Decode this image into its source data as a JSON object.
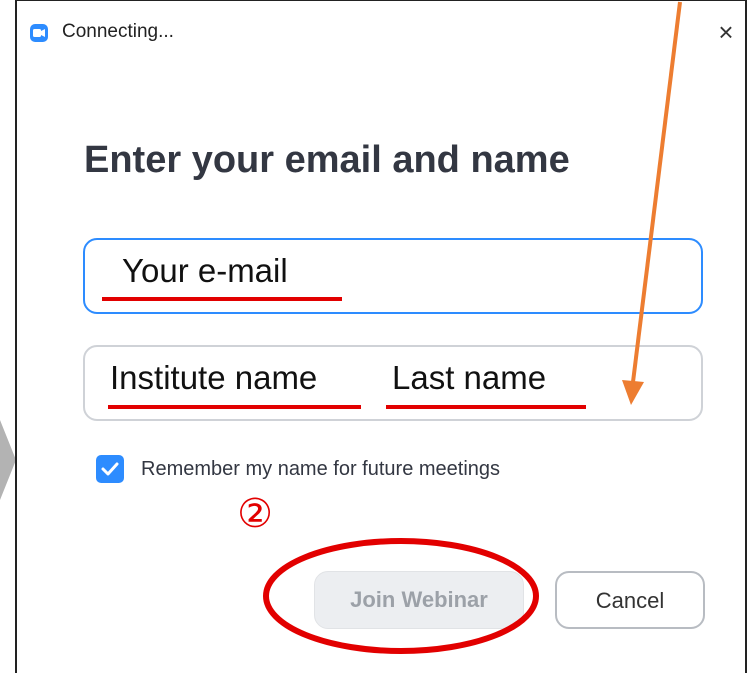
{
  "window": {
    "title": "Connecting...",
    "close_glyph": "×"
  },
  "heading": "Enter your email and name",
  "fields": {
    "email": {
      "value": "Your  e-mail"
    },
    "name": {
      "part1": "Institute name",
      "part2": "Last name"
    }
  },
  "remember": {
    "label": "Remember my name for future meetings",
    "checked": true
  },
  "step_badge": "②",
  "buttons": {
    "join": "Join Webinar",
    "cancel": "Cancel"
  },
  "colors": {
    "accent": "#2D8CFF",
    "annotation_red": "#e20000",
    "annotation_orange": "#ED7D31"
  }
}
